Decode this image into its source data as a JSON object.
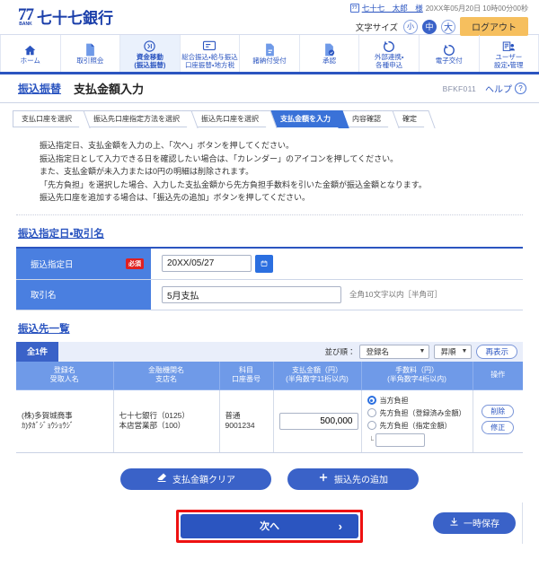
{
  "header": {
    "bank_logo_mark": "77",
    "bank_logo_sub": "BANK",
    "bank_name": "七十七銀行",
    "user_badge": "77",
    "user_name": "七十七　太郎　様",
    "login_time": "20XX年05月20日 10時00分00秒",
    "text_size_label": "文字サイズ",
    "size_small": "小",
    "size_medium": "中",
    "size_large": "大",
    "logout_label": "ログアウト"
  },
  "nav": {
    "items": [
      {
        "label": "ホーム",
        "icon": "home-icon",
        "active": false
      },
      {
        "label": "取引照会",
        "icon": "document-icon",
        "active": false
      },
      {
        "label": "資金移動\n(振込振替)",
        "line1": "資金移動",
        "line2": "(振込振替)",
        "icon": "transfer-icon",
        "active": true
      },
      {
        "label": "総合振込・給与振込\n口座振替・地方税",
        "line1": "総合振込・給与振込",
        "line2": "口座振替・地方税",
        "icon": "batch-transfer-icon",
        "active": false
      },
      {
        "label": "諸納付受付",
        "icon": "payment-icon",
        "active": false
      },
      {
        "label": "承認",
        "icon": "approve-icon",
        "active": false
      },
      {
        "label": "外部連携・\n各種申込",
        "line1": "外部連携・",
        "line2": "各種申込",
        "icon": "link-icon",
        "active": false
      },
      {
        "label": "電子交付",
        "icon": "edelivery-icon",
        "active": false
      },
      {
        "label": "ユーザー\n設定・管理",
        "line1": "ユーザー",
        "line2": "設定・管理",
        "icon": "user-settings-icon",
        "active": false
      }
    ]
  },
  "titlebar": {
    "category": "振込振替",
    "title": "支払金額入力",
    "screen_code": "BFKF011",
    "help_label": "ヘルプ",
    "help_icon_char": "?"
  },
  "steps": [
    {
      "label": "支払口座を選択",
      "current": false
    },
    {
      "label": "振込先口座指定方法を選択",
      "current": false
    },
    {
      "label": "振込先口座を選択",
      "current": false
    },
    {
      "label": "支払金額を入力",
      "current": true
    },
    {
      "label": "内容確認",
      "current": false
    },
    {
      "label": "確定",
      "current": false
    }
  ],
  "instructions": [
    "振込指定日、支払金額を入力の上、「次へ」ボタンを押してください。",
    "振込指定日として入力できる日を確認したい場合は、「カレンダー」のアイコンを押してください。",
    "また、支払金額が未入力または0円の明細は削除されます。",
    "「先方負担」を選択した場合、入力した支払金額から先方負担手数料を引いた金額が振込金額となります。",
    "振込先口座を追加する場合は、「振込先の追加」ボタンを押してください。"
  ],
  "date_section": {
    "title": "振込指定日・取引名",
    "rows": {
      "date_label": "振込指定日",
      "required_badge": "必須",
      "date_value": "20XX/05/27",
      "calendar_icon": "calendar-icon",
      "name_label": "取引名",
      "name_value": "5月支払",
      "name_hint": "全角10文字以内［半角可］"
    }
  },
  "list_section": {
    "title": "振込先一覧",
    "count_badge": "全1件",
    "sort_label": "並び順：",
    "sort_key": "登録名",
    "sort_order": "昇順",
    "redisplay_label": "再表示",
    "columns": [
      {
        "line1": "登録名",
        "line2": "受取人名"
      },
      {
        "line1": "金融機関名",
        "line2": "支店名"
      },
      {
        "line1": "科目",
        "line2": "口座番号"
      },
      {
        "line1": "支払金額（円）",
        "line2": "(半角数字11桁以内)"
      },
      {
        "line1": "手数料（円）",
        "line2": "(半角数字4桁以内)"
      },
      {
        "line1": "操作",
        "line2": ""
      }
    ],
    "rows": [
      {
        "registered_name": "(株)多賀城商事",
        "receiver_name": "ｶ)ﾀｶﾞｼﾞｮｳｼｮｳｼﾞ",
        "bank_name": "七十七銀行（0125）",
        "branch_name": "本店営業部（100）",
        "account_type": "普通",
        "account_number": "9001234",
        "amount": "500,000",
        "fee_options": [
          {
            "label": "当方負担",
            "selected": true
          },
          {
            "label": "先方負担（登録済み金額）",
            "selected": false
          },
          {
            "label": "先方負担（指定金額）",
            "selected": false
          }
        ],
        "fee_custom_value": "",
        "op_delete": "削除",
        "op_edit": "修正"
      }
    ]
  },
  "mid_actions": {
    "clear_label": "支払金額クリア",
    "clear_icon": "eraser-icon",
    "add_label": "振込先の追加",
    "add_icon": "plus-icon"
  },
  "footer": {
    "next_label": "次へ",
    "next_chevron": "›",
    "save_label": "一時保存",
    "save_icon": "download-icon"
  },
  "colors": {
    "brand_blue": "#2b55c0",
    "nav_active_bg": "#eaf1fc",
    "header_row_blue": "#4a7fe0",
    "table_header_blue": "#6f9ae8",
    "required_red": "#e02020",
    "logout_orange": "#f6bf5e",
    "highlight_red": "#ee1111"
  }
}
